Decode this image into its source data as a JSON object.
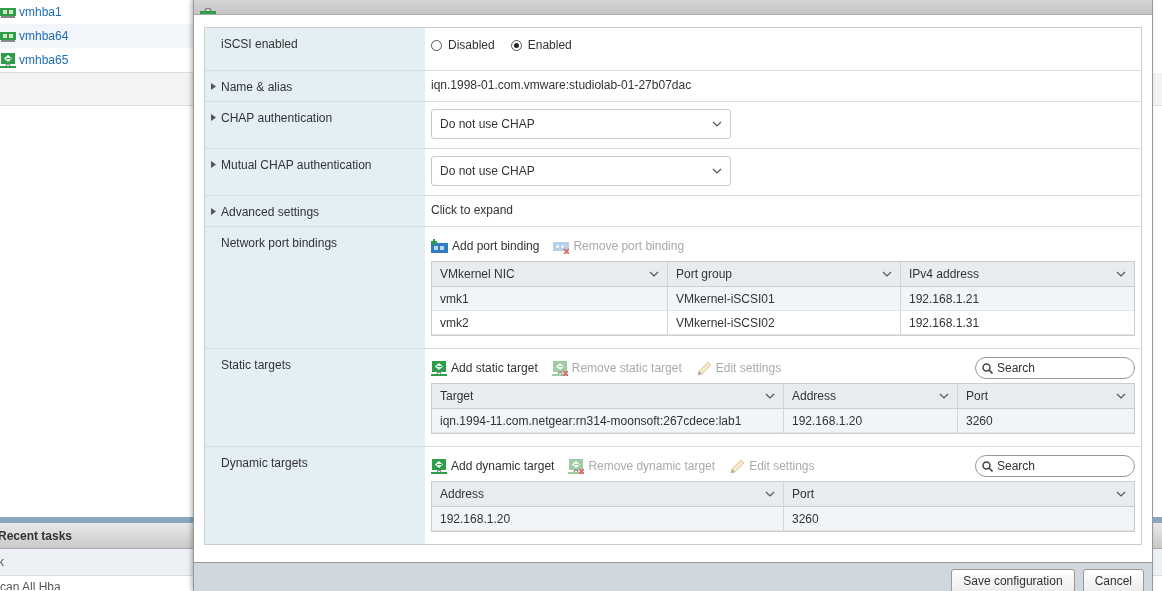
{
  "background": {
    "adapters": [
      {
        "name": "vmhba1",
        "kind": "nic"
      },
      {
        "name": "vmhba64",
        "kind": "nic"
      },
      {
        "name": "vmhba65",
        "kind": "iscsi"
      }
    ],
    "recent_tasks": {
      "title": "Recent tasks",
      "column_1": "k",
      "rows": [
        "can All Hba"
      ]
    }
  },
  "dialog": {
    "rows": [
      {
        "kind": "radio",
        "label": "iSCSI enabled",
        "options": [
          {
            "label": "Disabled",
            "selected": false
          },
          {
            "label": "Enabled",
            "selected": true
          }
        ]
      },
      {
        "kind": "text",
        "label": "Name & alias",
        "expanded": false,
        "value": "iqn.1998-01.com.vmware:studiolab-01-27b07dac"
      },
      {
        "kind": "select",
        "label": "CHAP authentication",
        "expanded": false,
        "value": "Do not use CHAP"
      },
      {
        "kind": "select",
        "label": "Mutual CHAP authentication",
        "expanded": false,
        "value": "Do not use CHAP"
      },
      {
        "kind": "text",
        "label": "Advanced settings",
        "expanded": false,
        "value": "Click to expand"
      },
      {
        "kind": "port-table",
        "label": "Network port bindings",
        "actions": [
          {
            "kind": "add-binding",
            "label": "Add port binding",
            "disabled": false
          },
          {
            "kind": "remove-binding",
            "label": "Remove port binding",
            "disabled": true
          }
        ],
        "columns": [
          "VMkernel NIC",
          "Port group",
          "IPv4 address"
        ],
        "rows": [
          [
            "vmk1",
            "VMkernel-iSCSI01",
            "192.168.1.21"
          ],
          [
            "vmk2",
            "VMkernel-iSCSI02",
            "192.168.1.31"
          ]
        ]
      },
      {
        "kind": "target-table",
        "label": "Static targets",
        "actions": [
          {
            "kind": "add-target",
            "label": "Add static target",
            "disabled": false
          },
          {
            "kind": "remove-target",
            "label": "Remove static target",
            "disabled": true
          },
          {
            "kind": "edit",
            "label": "Edit settings",
            "disabled": true
          }
        ],
        "search": {
          "placeholder": "Search"
        },
        "columns": [
          "Target",
          "Address",
          "Port"
        ],
        "rows": [
          [
            "iqn.1994-11.com.netgear:rn314-moonsoft:267cdece:lab1",
            "192.168.1.20",
            "3260"
          ]
        ]
      },
      {
        "kind": "target-table",
        "label": "Dynamic targets",
        "actions": [
          {
            "kind": "add-target",
            "label": "Add dynamic target",
            "disabled": false
          },
          {
            "kind": "remove-target",
            "label": "Remove dynamic target",
            "disabled": true
          },
          {
            "kind": "edit",
            "label": "Edit settings",
            "disabled": true
          }
        ],
        "search": {
          "placeholder": "Search"
        },
        "columns": [
          "Address",
          "Port"
        ],
        "rows": [
          [
            "192.168.1.20",
            "3260"
          ]
        ]
      }
    ],
    "buttons": [
      "Save configuration",
      "Cancel"
    ]
  }
}
